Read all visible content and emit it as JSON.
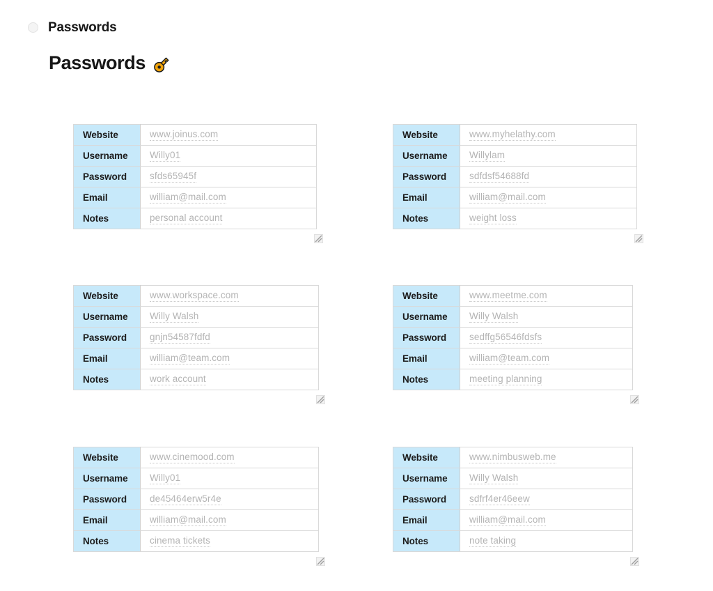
{
  "header": {
    "bullet_label": "Passwords",
    "bullet_icon": "radio-unselected-icon",
    "title": "Passwords",
    "title_icon": "key-icon"
  },
  "table": {
    "row_labels": [
      "Website",
      "Username",
      "Password",
      "Email",
      "Notes"
    ],
    "resize_icon": "resize-grip-icon"
  },
  "colors": {
    "label_cell_bg": "#c7e9fa",
    "value_text": "#b4b4b4",
    "border": "#d9d9d9",
    "page_bg": "#ffffff",
    "key_body": "#f0a30a"
  },
  "entries": [
    {
      "website": "www.joinus.com",
      "username": "Willy01",
      "password": "sfds65945f",
      "email": "william@mail.com",
      "notes": "personal account"
    },
    {
      "website": "www.myhelathy.com",
      "username": "Willylam",
      "password": "sdfdsf54688fd",
      "email": "william@mail.com",
      "notes": "weight loss"
    },
    {
      "website": "www.workspace.com",
      "username": "Willy Walsh",
      "password": "gnjn54587fdfd",
      "email": "william@team.com",
      "notes": "work account"
    },
    {
      "website": "www.meetme.com",
      "username": "Willy Walsh",
      "password": "sedffg56546fdsfs",
      "email": "william@team.com",
      "notes": "meeting planning"
    },
    {
      "website": "www.cinemood.com",
      "username": "Willy01",
      "password": "de45464erw5r4e",
      "email": "william@mail.com",
      "notes": "cinema tickets"
    },
    {
      "website": "www.nimbusweb.me",
      "username": "Willy Walsh",
      "password": "sdfrf4er46eew",
      "email": "william@mail.com",
      "notes": "note taking"
    }
  ]
}
